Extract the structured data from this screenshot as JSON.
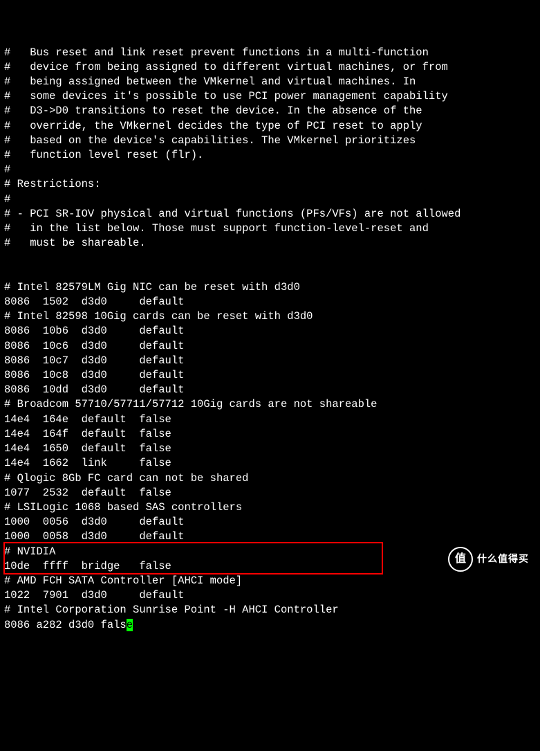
{
  "lines": [
    "#   Bus reset and link reset prevent functions in a multi-function",
    "#   device from being assigned to different virtual machines, or from",
    "#   being assigned between the VMkernel and virtual machines. In",
    "#   some devices it's possible to use PCI power management capability",
    "#   D3->D0 transitions to reset the device. In the absence of the",
    "#   override, the VMkernel decides the type of PCI reset to apply",
    "#   based on the device's capabilities. The VMkernel prioritizes",
    "#   function level reset (flr).",
    "#",
    "# Restrictions:",
    "#",
    "# - PCI SR-IOV physical and virtual functions (PFs/VFs) are not allowed",
    "#   in the list below. Those must support function-level-reset and",
    "#   must be shareable.",
    "",
    "",
    "# Intel 82579LM Gig NIC can be reset with d3d0",
    "8086  1502  d3d0     default",
    "# Intel 82598 10Gig cards can be reset with d3d0",
    "8086  10b6  d3d0     default",
    "8086  10c6  d3d0     default",
    "8086  10c7  d3d0     default",
    "8086  10c8  d3d0     default",
    "8086  10dd  d3d0     default",
    "# Broadcom 57710/57711/57712 10Gig cards are not shareable",
    "14e4  164e  default  false",
    "14e4  164f  default  false",
    "14e4  1650  default  false",
    "14e4  1662  link     false",
    "# Qlogic 8Gb FC card can not be shared",
    "1077  2532  default  false",
    "# LSILogic 1068 based SAS controllers",
    "1000  0056  d3d0     default",
    "1000  0058  d3d0     default",
    "# NVIDIA",
    "10de  ffff  bridge   false",
    "# AMD FCH SATA Controller [AHCI mode]",
    "1022  7901  d3d0     default",
    "# Intel Corporation Sunrise Point -H AHCI Controller"
  ],
  "last_line_prefix": "8086 a282 d3d0 fals",
  "last_line_cursor": "e",
  "watermark_char": "值",
  "watermark_text": "什么值得买"
}
